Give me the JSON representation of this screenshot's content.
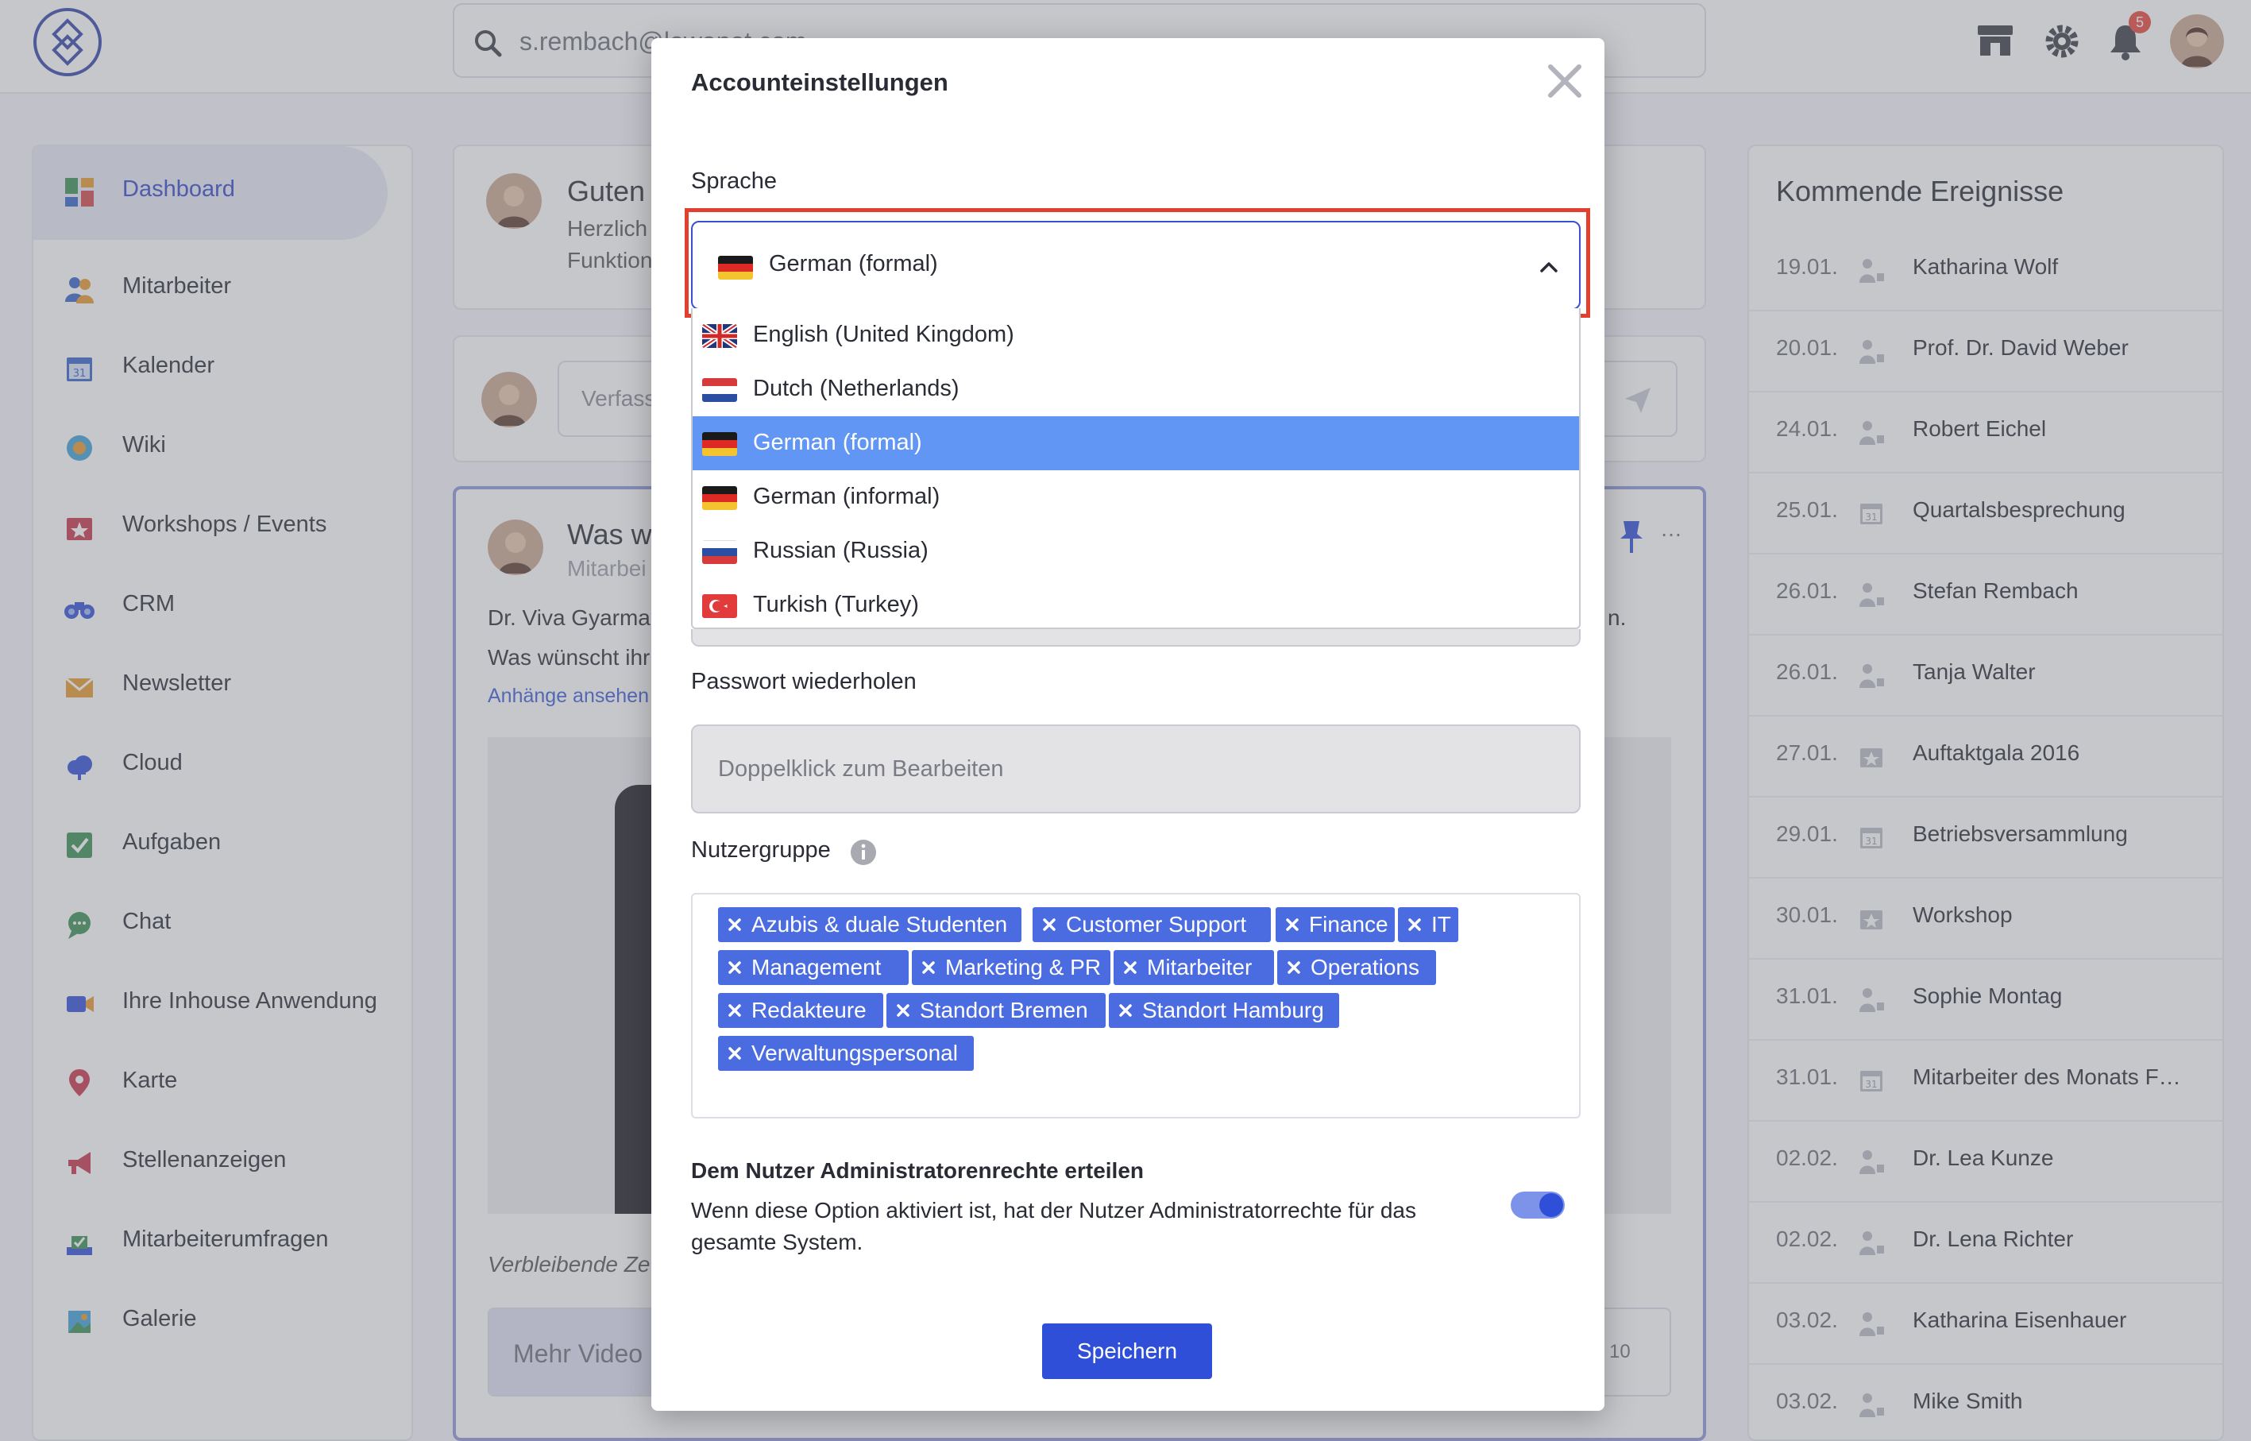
{
  "topbar": {
    "search_value": "s.rembach@lowanet.com",
    "notification_count": "5",
    "icons": [
      "logo-icon",
      "search-icon",
      "store-icon",
      "gear-icon",
      "bell-icon",
      "avatar"
    ]
  },
  "sidebar": {
    "items": [
      {
        "label": "Dashboard",
        "icon": "dashboard-icon",
        "active": true
      },
      {
        "label": "Mitarbeiter",
        "icon": "users-icon"
      },
      {
        "label": "Kalender",
        "icon": "calendar-icon"
      },
      {
        "label": "Wiki",
        "icon": "wiki-icon"
      },
      {
        "label": "Workshops / Events",
        "icon": "events-icon"
      },
      {
        "label": "CRM",
        "icon": "binoculars-icon"
      },
      {
        "label": "Newsletter",
        "icon": "mail-icon"
      },
      {
        "label": "Cloud",
        "icon": "cloud-icon"
      },
      {
        "label": "Aufgaben",
        "icon": "tasks-icon"
      },
      {
        "label": "Chat",
        "icon": "chat-icon"
      },
      {
        "label": "Ihre Inhouse Anwendung",
        "icon": "app-icon"
      },
      {
        "label": "Karte",
        "icon": "map-pin-icon"
      },
      {
        "label": "Stellenanzeigen",
        "icon": "megaphone-icon"
      },
      {
        "label": "Mitarbeiterumfragen",
        "icon": "survey-icon"
      },
      {
        "label": "Galerie",
        "icon": "gallery-icon"
      }
    ]
  },
  "feed": {
    "greeting_title": "Guten",
    "greeting_line1": "Herzlich",
    "greeting_line2": "Funktion",
    "compose_placeholder": "Verfass",
    "post_title": "Was w",
    "post_subtitle": "Mitarbei",
    "post_text1": "Dr. Viva Gyarma",
    "post_text2": "Was wünscht ihr",
    "post_text_end": "n.",
    "post_link": "Anhänge ansehen",
    "remaining": "Verbleibende Ze",
    "more_videos": "Mehr Video",
    "count": "10"
  },
  "events": {
    "title": "Kommende Ereignisse",
    "items": [
      {
        "date": "19.01.",
        "name": "Katharina Wolf",
        "icon": "birthday-icon"
      },
      {
        "date": "20.01.",
        "name": "Prof. Dr. David Weber",
        "icon": "birthday-icon"
      },
      {
        "date": "24.01.",
        "name": "Robert Eichel",
        "icon": "birthday-icon"
      },
      {
        "date": "25.01.",
        "name": "Quartalsbesprechung",
        "icon": "calendar-icon"
      },
      {
        "date": "26.01.",
        "name": "Stefan Rembach",
        "icon": "birthday-icon"
      },
      {
        "date": "26.01.",
        "name": "Tanja Walter",
        "icon": "birthday-icon"
      },
      {
        "date": "27.01.",
        "name": "Auftaktgala 2016",
        "icon": "star-icon"
      },
      {
        "date": "29.01.",
        "name": "Betriebsversammlung",
        "icon": "calendar-icon"
      },
      {
        "date": "30.01.",
        "name": "Workshop",
        "icon": "star-icon"
      },
      {
        "date": "31.01.",
        "name": "Sophie Montag",
        "icon": "birthday-icon"
      },
      {
        "date": "31.01.",
        "name": "Mitarbeiter des Monats F…",
        "icon": "calendar-icon"
      },
      {
        "date": "02.02.",
        "name": "Dr. Lea Kunze",
        "icon": "birthday-icon"
      },
      {
        "date": "02.02.",
        "name": "Dr. Lena Richter",
        "icon": "birthday-icon"
      },
      {
        "date": "03.02.",
        "name": "Katharina Eisenhauer",
        "icon": "birthday-icon"
      },
      {
        "date": "03.02.",
        "name": "Mike Smith",
        "icon": "birthday-icon"
      }
    ]
  },
  "modal": {
    "title": "Accounteinstellungen",
    "close_icon": "close-icon",
    "language_label": "Sprache",
    "language_selected": "German (formal)",
    "language_options": [
      {
        "label": "English (United Kingdom)",
        "flag": "gb"
      },
      {
        "label": "Dutch (Netherlands)",
        "flag": "nl"
      },
      {
        "label": "German (formal)",
        "flag": "de",
        "selected": true
      },
      {
        "label": "German (informal)",
        "flag": "de"
      },
      {
        "label": "Russian (Russia)",
        "flag": "ru"
      },
      {
        "label": "Turkish (Turkey)",
        "flag": "tr"
      }
    ],
    "password_repeat_label": "Passwort wiederholen",
    "password_repeat_placeholder": "Doppelklick zum Bearbeiten",
    "usergroup_label": "Nutzergruppe",
    "usergroups": [
      "Azubis & duale Studenten",
      "Customer Support",
      "Finance",
      "IT",
      "Management",
      "Marketing & PR",
      "Mitarbeiter",
      "Operations",
      "Redakteure",
      "Standort Bremen",
      "Standort Hamburg",
      "Verwaltungspersonal"
    ],
    "admin_title": "Dem Nutzer Administratorenrechte erteilen",
    "admin_desc": "Wenn diese Option aktiviert ist, hat der Nutzer Administratorrechte für das gesamte System.",
    "admin_enabled": true,
    "save_label": "Speichern"
  },
  "colors": {
    "accent": "#2f4fd8",
    "tag": "#4a6ce0",
    "selected_option": "#6196f4",
    "highlight": "#e2402f"
  }
}
